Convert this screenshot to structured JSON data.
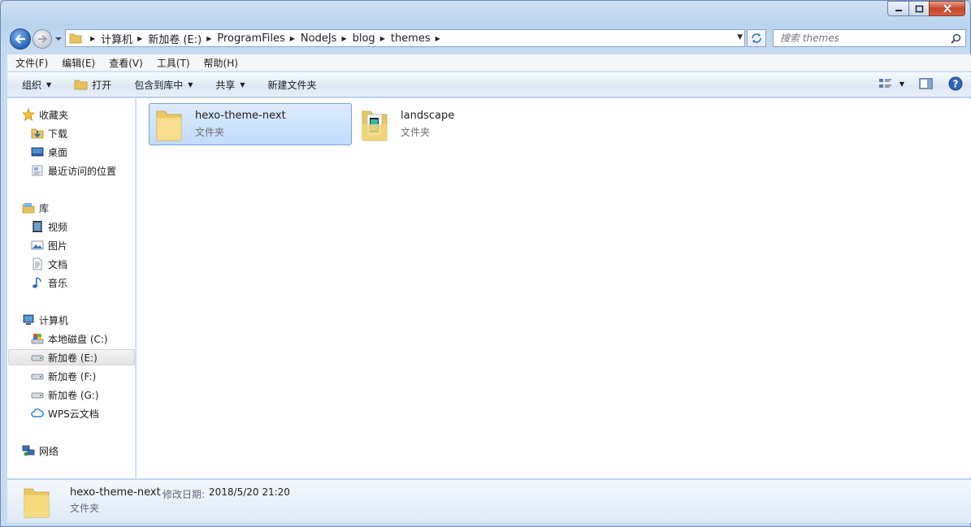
{
  "breadcrumb": [
    "计算机",
    "新加卷 (E:)",
    "ProgramFiles",
    "NodeJs",
    "blog",
    "themes"
  ],
  "search": {
    "placeholder": "搜索 themes"
  },
  "menu": [
    "文件(F)",
    "编辑(E)",
    "查看(V)",
    "工具(T)",
    "帮助(H)"
  ],
  "toolbar": {
    "organize": "组织",
    "open": "打开",
    "include_library": "包含到库中",
    "share": "共享",
    "new_folder": "新建文件夹"
  },
  "nav": {
    "favorites": "收藏夹",
    "favorites_items": [
      "下载",
      "桌面",
      "最近访问的位置"
    ],
    "libraries": "库",
    "libraries_items": [
      "视频",
      "图片",
      "文档",
      "音乐"
    ],
    "computer": "计算机",
    "computer_items": [
      "本地磁盘 (C:)",
      "新加卷 (E:)",
      "新加卷 (F:)",
      "新加卷 (G:)",
      "WPS云文档"
    ],
    "network": "网络"
  },
  "files": [
    {
      "name": "hexo-theme-next",
      "type": "文件夹"
    },
    {
      "name": "landscape",
      "type": "文件夹"
    }
  ],
  "details": {
    "name": "hexo-theme-next",
    "date_label": "修改日期:",
    "date": "2018/5/20 21:20",
    "type": "文件夹"
  },
  "colors": {
    "selection": "#cce4fc",
    "folder": "#f3d67e",
    "accent": "#2d63b6"
  }
}
